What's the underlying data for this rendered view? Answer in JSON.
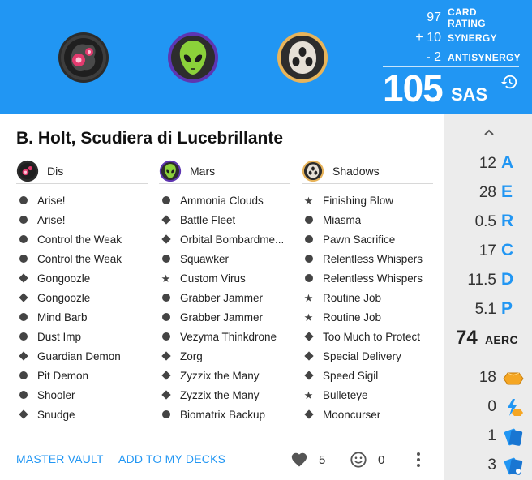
{
  "houses": [
    {
      "name": "Dis",
      "icon": "dis-icon"
    },
    {
      "name": "Mars",
      "icon": "mars-icon"
    },
    {
      "name": "Shadows",
      "icon": "shadows-icon"
    }
  ],
  "scores": {
    "card_rating": {
      "value": "97",
      "label": "CARD RATING"
    },
    "synergy": {
      "value": "+ 10",
      "label": "SYNERGY"
    },
    "antisynergy": {
      "value": "- 2",
      "label": "ANTISYNERGY"
    },
    "sas": {
      "value": "105",
      "label": "SAS"
    }
  },
  "deck": {
    "title": "B. Holt, Scudiera di Lucebrillante",
    "columns": [
      {
        "house": "Dis",
        "cards": [
          {
            "name": "Arise!",
            "rarity": "common"
          },
          {
            "name": "Arise!",
            "rarity": "common"
          },
          {
            "name": "Control the Weak",
            "rarity": "common"
          },
          {
            "name": "Control the Weak",
            "rarity": "common"
          },
          {
            "name": "Gongoozle",
            "rarity": "uncommon"
          },
          {
            "name": "Gongoozle",
            "rarity": "uncommon"
          },
          {
            "name": "Mind Barb",
            "rarity": "common"
          },
          {
            "name": "Dust Imp",
            "rarity": "common"
          },
          {
            "name": "Guardian Demon",
            "rarity": "uncommon"
          },
          {
            "name": "Pit Demon",
            "rarity": "common"
          },
          {
            "name": "Shooler",
            "rarity": "common"
          },
          {
            "name": "Snudge",
            "rarity": "uncommon"
          }
        ]
      },
      {
        "house": "Mars",
        "cards": [
          {
            "name": "Ammonia Clouds",
            "rarity": "common"
          },
          {
            "name": "Battle Fleet",
            "rarity": "uncommon"
          },
          {
            "name": "Orbital Bombardme...",
            "rarity": "uncommon"
          },
          {
            "name": "Squawker",
            "rarity": "common"
          },
          {
            "name": "Custom Virus",
            "rarity": "rare"
          },
          {
            "name": "Grabber Jammer",
            "rarity": "common"
          },
          {
            "name": "Grabber Jammer",
            "rarity": "common"
          },
          {
            "name": "Vezyma Thinkdrone",
            "rarity": "common"
          },
          {
            "name": "Zorg",
            "rarity": "uncommon"
          },
          {
            "name": "Zyzzix the Many",
            "rarity": "uncommon"
          },
          {
            "name": "Zyzzix the Many",
            "rarity": "uncommon"
          },
          {
            "name": "Biomatrix Backup",
            "rarity": "common"
          }
        ]
      },
      {
        "house": "Shadows",
        "cards": [
          {
            "name": "Finishing Blow",
            "rarity": "rare"
          },
          {
            "name": "Miasma",
            "rarity": "common"
          },
          {
            "name": "Pawn Sacrifice",
            "rarity": "common"
          },
          {
            "name": "Relentless Whispers",
            "rarity": "common"
          },
          {
            "name": "Relentless Whispers",
            "rarity": "common"
          },
          {
            "name": "Routine Job",
            "rarity": "rare"
          },
          {
            "name": "Routine Job",
            "rarity": "rare"
          },
          {
            "name": "Too Much to Protect",
            "rarity": "uncommon"
          },
          {
            "name": "Special Delivery",
            "rarity": "uncommon"
          },
          {
            "name": "Speed Sigil",
            "rarity": "uncommon"
          },
          {
            "name": "Bulleteye",
            "rarity": "rare"
          },
          {
            "name": "Mooncurser",
            "rarity": "uncommon"
          }
        ]
      }
    ]
  },
  "footer": {
    "master_vault_label": "MASTER VAULT",
    "add_to_decks_label": "ADD TO MY DECKS",
    "likes": "5",
    "funny": "0"
  },
  "sidebar": {
    "stats": [
      {
        "value": "12",
        "label": "A"
      },
      {
        "value": "28",
        "label": "E"
      },
      {
        "value": "0.5",
        "label": "R"
      },
      {
        "value": "17",
        "label": "C"
      },
      {
        "value": "11.5",
        "label": "D"
      },
      {
        "value": "5.1",
        "label": "P"
      }
    ],
    "aerc": {
      "value": "74",
      "label": "AERC"
    },
    "extra": [
      {
        "value": "18",
        "icon": "amber-icon"
      },
      {
        "value": "0",
        "icon": "amber-efficiency-icon"
      },
      {
        "value": "1",
        "icon": "action-cards-icon"
      },
      {
        "value": "3",
        "icon": "upgrade-cards-icon"
      }
    ]
  },
  "colors": {
    "primary": "#2196f3",
    "sidebar_bg": "#ececec",
    "dis": "#d8366b",
    "mars": "#5e35b1",
    "shadows": "#e8b45a",
    "amber": "#f5a623"
  }
}
